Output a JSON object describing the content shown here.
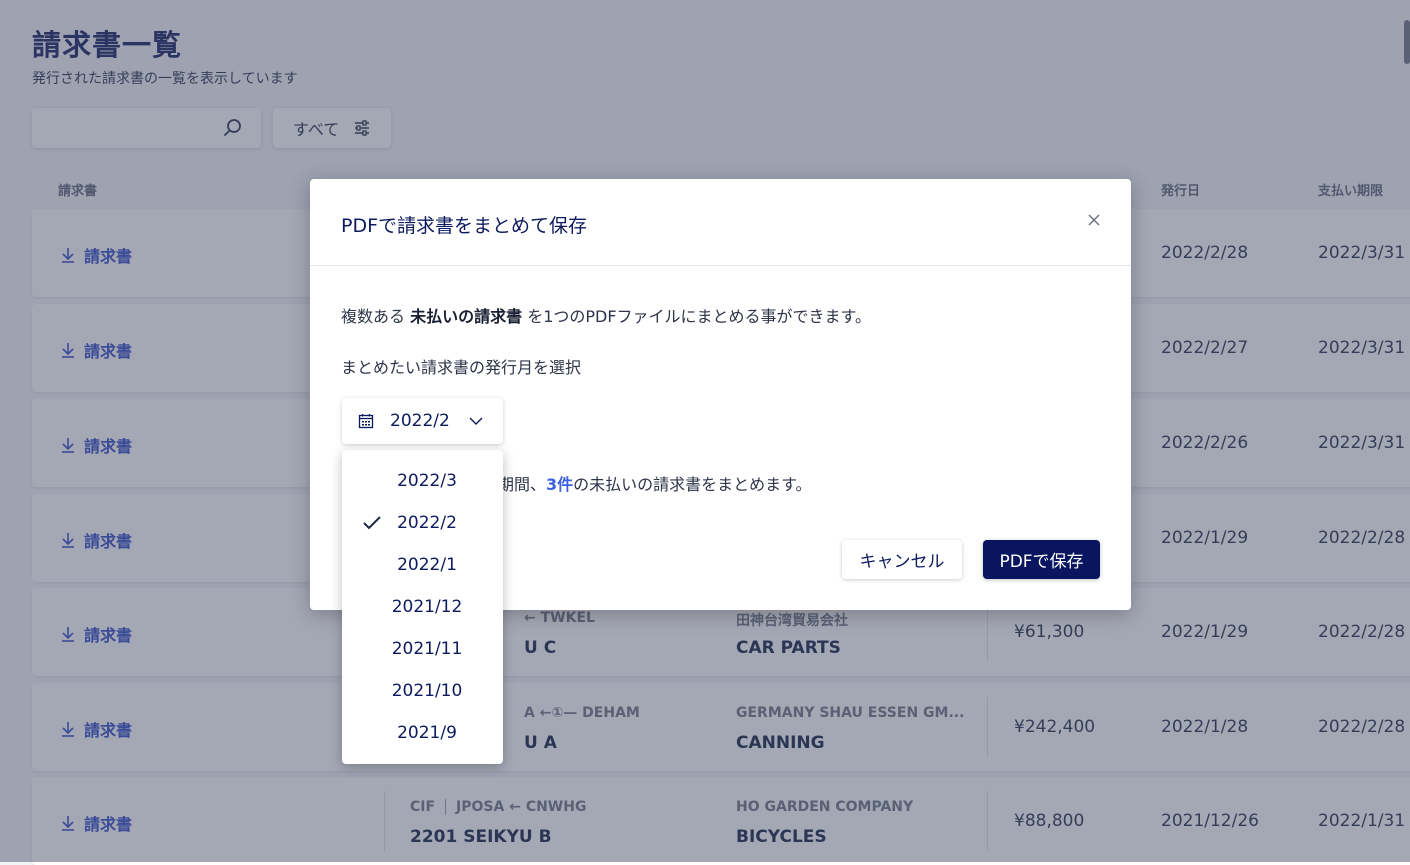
{
  "page": {
    "title": "請求書一覧",
    "subtitle": "発行された請求書の一覧を表示しています"
  },
  "search": {
    "placeholder": "",
    "value": ""
  },
  "filter": {
    "label": "すべて"
  },
  "table": {
    "headers": {
      "invoice": "請求書",
      "issued": "発行日",
      "due": "支払い期限"
    },
    "download_label": "請求書",
    "rows": [
      {
        "route": "",
        "incoterm": "",
        "seikyu": "",
        "company": "",
        "cargo": "",
        "amount": "",
        "issued": "2022/2/28",
        "due": "2022/3/31"
      },
      {
        "route": "",
        "incoterm": "",
        "seikyu": "",
        "company": "",
        "cargo": "",
        "amount": "",
        "issued": "2022/2/27",
        "due": "2022/3/31"
      },
      {
        "route": "",
        "incoterm": "",
        "seikyu": "",
        "company": "",
        "cargo": "",
        "amount": "",
        "issued": "2022/2/26",
        "due": "2022/3/31"
      },
      {
        "route": "",
        "incoterm": "",
        "seikyu": "",
        "company": "",
        "cargo": "",
        "amount": "",
        "issued": "2022/1/29",
        "due": "2022/2/28"
      },
      {
        "route": "← TWKEL",
        "incoterm": "",
        "seikyu": "U C",
        "company": "田神台湾貿易会社",
        "cargo": "CAR PARTS",
        "amount": "¥61,300",
        "issued": "2022/1/29",
        "due": "2022/2/28"
      },
      {
        "route": "A ←①— DEHAM",
        "incoterm": "",
        "seikyu": "U A",
        "company": "GERMANY SHAU ESSEN GM...",
        "cargo": "CANNING",
        "amount": "¥242,400",
        "issued": "2022/1/28",
        "due": "2022/2/28"
      },
      {
        "route": "JPOSA ← CNWHG",
        "incoterm": "CIF",
        "seikyu": "2201 SEIKYU B",
        "company": "HO GARDEN COMPANY",
        "cargo": "BICYCLES",
        "amount": "¥88,800",
        "issued": "2021/12/26",
        "due": "2022/1/31"
      }
    ]
  },
  "modal": {
    "title": "PDFで請求書をまとめて保存",
    "desc_before": "複数ある ",
    "desc_bold": "未払いの請求書",
    "desc_after": " を1つのPDFファイルにまとめる事ができます。",
    "select_label": "まとめたい請求書の発行月を選択",
    "selected_month": "2022/2",
    "summary_before": "期間、",
    "summary_count": "3件",
    "summary_after": "の未払いの請求書をまとめます。",
    "cancel_label": "キャンセル",
    "save_label": "PDFで保存"
  },
  "dropdown": {
    "options": [
      "2022/3",
      "2022/2",
      "2022/1",
      "2021/12",
      "2021/11",
      "2021/10",
      "2021/9"
    ],
    "selected": "2022/2"
  },
  "colors": {
    "primary": "#0a1560",
    "link": "#2b47c4",
    "accent_count": "#3a5fe0",
    "overlay": "#4a5069"
  }
}
